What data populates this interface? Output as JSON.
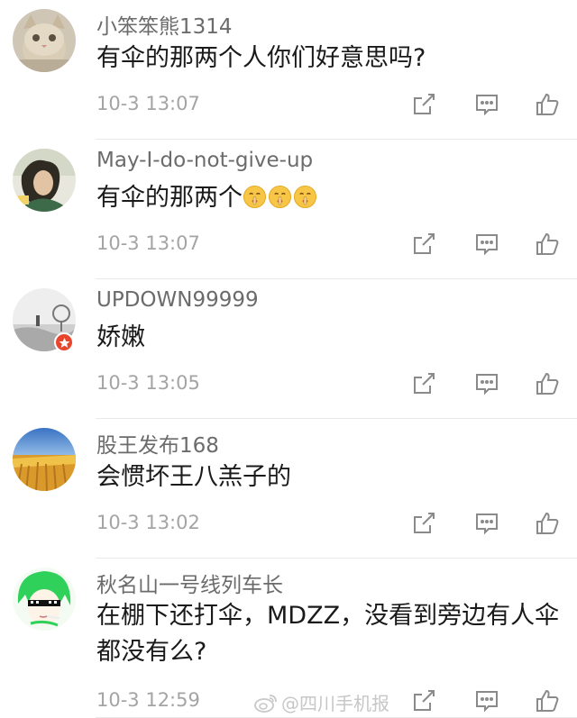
{
  "comments": [
    {
      "username": "小笨笨熊1314",
      "content": "有伞的那两个人你们好意思吗?",
      "timestamp": "10-3 13:07",
      "avatar": "cat-photo"
    },
    {
      "username": "May-I-do-not-give-up",
      "content": "有伞的那两个",
      "emoji_count": 3,
      "emoji": "shushing-face-emoji",
      "timestamp": "10-3 13:07",
      "avatar": "girl-photo"
    },
    {
      "username": "UPDOWN99999",
      "content": "娇嫩",
      "timestamp": "10-3 13:05",
      "avatar": "landscape-photo",
      "badge": "vip-star-badge"
    },
    {
      "username": "股王发布168",
      "content": "会惯坏王八羔子的",
      "timestamp": "10-3 13:02",
      "avatar": "wheat-field-photo"
    },
    {
      "username": "秋名山一号线列车长",
      "content": "在棚下还打伞，MDZZ，没看到旁边有人伞都没有么?",
      "timestamp": "10-3 12:59",
      "avatar": "green-hair-sunglasses-cartoon"
    }
  ],
  "actions": {
    "share_icon": "share-icon",
    "reply_icon": "comment-icon",
    "like_icon": "thumbs-up-icon"
  },
  "watermark": {
    "text": "@四川手机报",
    "icon": "weibo-logo"
  },
  "colors": {
    "username": "#6b6b6b",
    "content": "#1a1a1a",
    "timestamp": "#a4a4a4",
    "icon": "#8a8a8a",
    "badge": "#e8452c"
  }
}
